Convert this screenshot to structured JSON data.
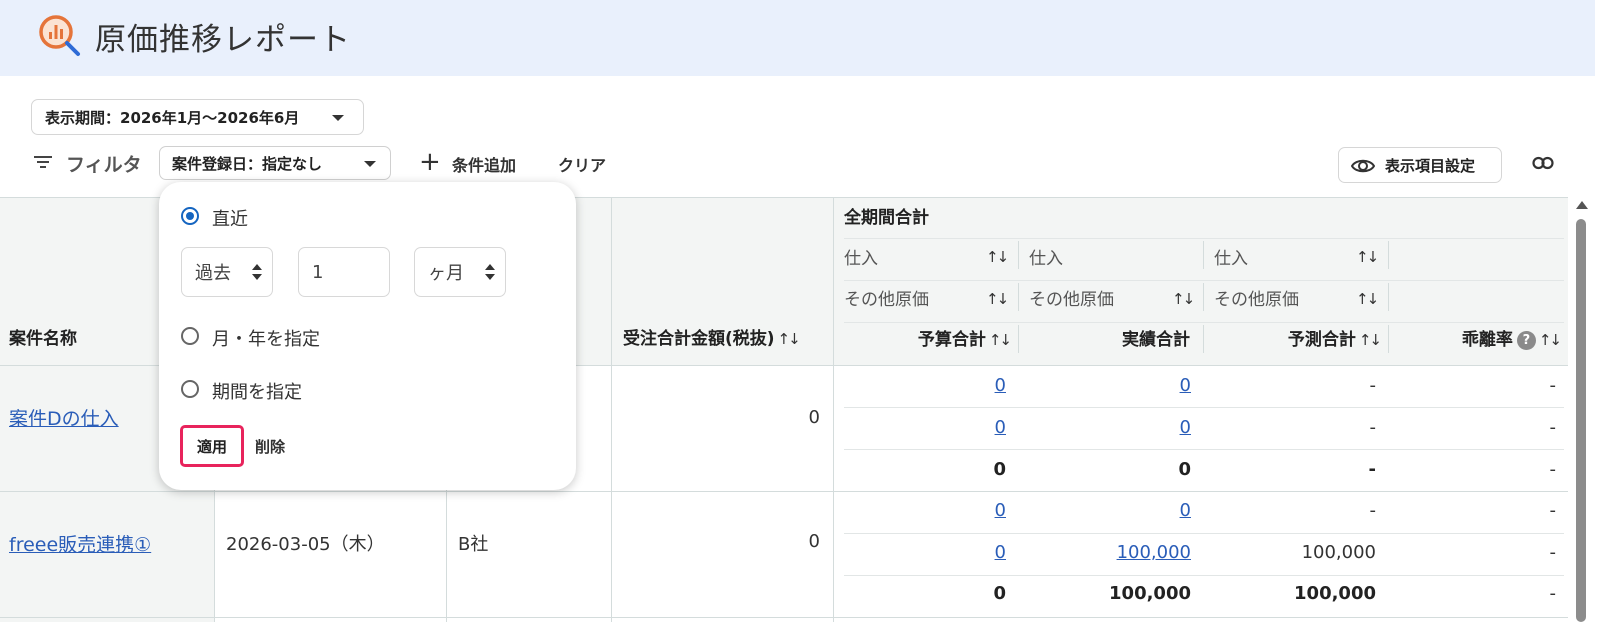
{
  "header": {
    "title": "原価推移レポート",
    "icon": "report-search-icon"
  },
  "period": {
    "label": "表示期間：2026年1月〜2026年6月"
  },
  "filter": {
    "label": "フィルタ",
    "chip_label": "案件登録日：指定なし",
    "add_label": "条件追加",
    "clear_label": "クリア"
  },
  "toolbar": {
    "display_settings_label": "表示項目設定",
    "link_icon": "link-icon"
  },
  "table": {
    "col_project": "案件名称",
    "col_order_total": "受注合計金額(税抜)",
    "group_header": "全期間合計",
    "sub1": [
      "仕入",
      "仕入",
      "仕入"
    ],
    "sub2": [
      "その他原価",
      "その他原価",
      "その他原価"
    ],
    "col_budget": "予算合計",
    "col_actual": "実績合計",
    "col_forecast": "予測合計",
    "col_deviation": "乖離率",
    "help_glyph": "?",
    "sort_glyph": "↑↓",
    "rows": [
      {
        "name": "案件Dの仕入",
        "date": "",
        "client": "",
        "order_total": "0",
        "sub": [
          {
            "budget": "0",
            "actual": "0",
            "forecast": "-",
            "deviation": "-"
          },
          {
            "budget": "0",
            "actual": "0",
            "forecast": "-",
            "deviation": "-"
          },
          {
            "budget": "0",
            "actual": "0",
            "forecast": "-",
            "deviation": "-"
          }
        ]
      },
      {
        "name": "freee販売連携①",
        "date": "2026-03-05（木）",
        "client": "B社",
        "order_total": "0",
        "sub": [
          {
            "budget": "0",
            "actual": "0",
            "forecast": "-",
            "deviation": "-"
          },
          {
            "budget": "0",
            "actual": "100,000",
            "forecast": "100,000",
            "deviation": "-"
          },
          {
            "budget": "0",
            "actual": "100,000",
            "forecast": "100,000",
            "deviation": "-"
          }
        ]
      }
    ]
  },
  "popover": {
    "option_recent": "直近",
    "past_select": "過去",
    "amount_value": "1",
    "unit_select": "ヶ月",
    "option_month_year": "月・年を指定",
    "option_range": "期間を指定",
    "apply_label": "適用",
    "delete_label": "削除"
  }
}
